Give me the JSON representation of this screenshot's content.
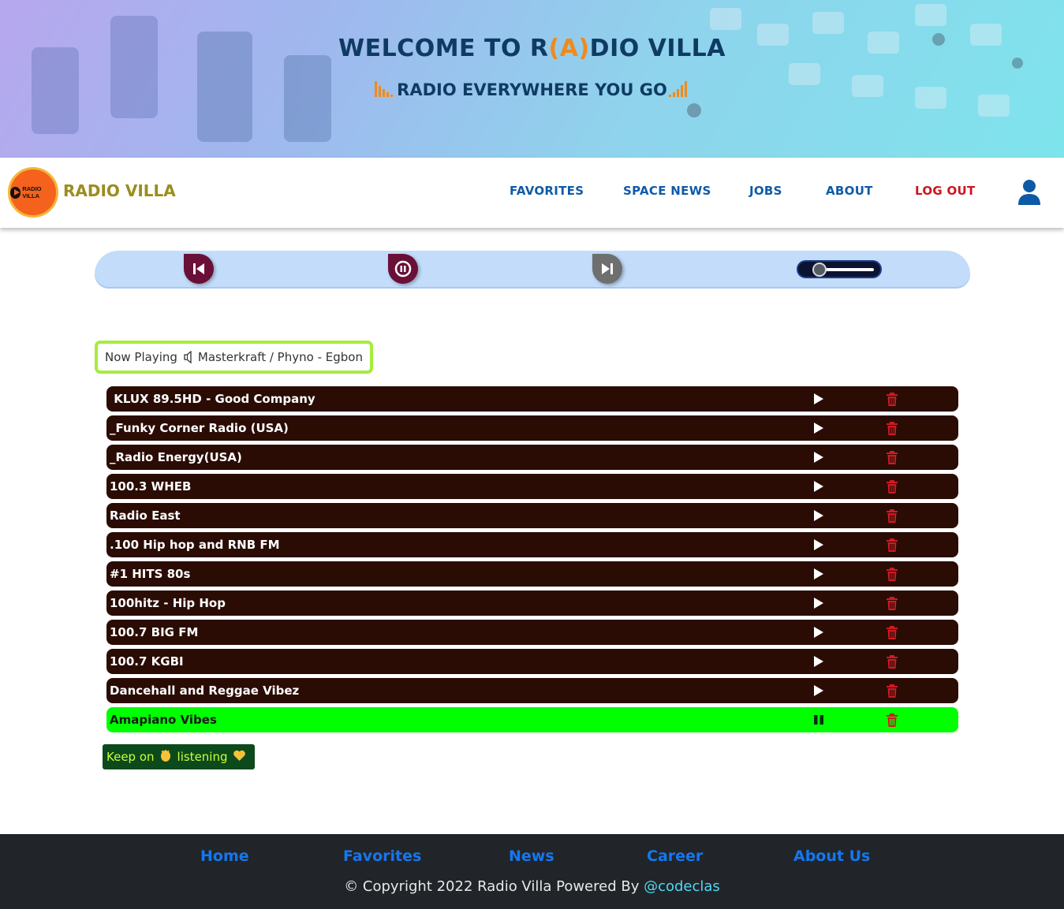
{
  "hero": {
    "title_pre": "WELCOME TO R",
    "title_ant": "A",
    "title_post": "DIO VILLA",
    "subtitle": "RADIO EVERYWHERE YOU GO",
    "accent": "#f08a1c"
  },
  "navbar": {
    "logo_text": "RADIO VILLA",
    "brand": "RADIO VILLA",
    "links": [
      "FAVORITES",
      "SPACE NEWS",
      "JOBS",
      "ABOUT",
      "LOG OUT"
    ]
  },
  "player": {
    "prev_icon": "skip-back-icon",
    "pause_icon": "pause-icon",
    "next_icon": "skip-forward-icon",
    "volume_level": 0.05
  },
  "now_playing": {
    "label": "Now Playing",
    "track": "Masterkraft / Phyno - Egbon"
  },
  "stations": [
    {
      "name": " KLUX 89.5HD - Good Company",
      "state": "play"
    },
    {
      "name": "_Funky Corner Radio (USA)",
      "state": "play"
    },
    {
      "name": "_Radio Energy(USA)",
      "state": "play"
    },
    {
      "name": "100.3 WHEB",
      "state": "play"
    },
    {
      "name": "Radio East",
      "state": "play"
    },
    {
      "name": ".100 Hip hop and RNB FM",
      "state": "play"
    },
    {
      "name": "#1 HITS 80s",
      "state": "play"
    },
    {
      "name": "100hitz - Hip Hop",
      "state": "play"
    },
    {
      "name": "100.7 BIG FM",
      "state": "play"
    },
    {
      "name": "100.7 KGBI",
      "state": "play"
    },
    {
      "name": "Dancehall and Reggae Vibez",
      "state": "play"
    },
    {
      "name": "Amapiano Vibes",
      "state": "pause"
    }
  ],
  "keep": {
    "pre": "Keep on",
    "post": "listening",
    "emoji1": "👏",
    "emoji2": "💛"
  },
  "footer": {
    "links": [
      "Home",
      "Favorites",
      "News",
      "Career",
      "About Us"
    ],
    "copyright": "© Copyright 2022 Radio Villa Powered By ",
    "handle": "@codeclas"
  },
  "colors": {
    "row_bg": "#2a0c04",
    "row_active": "#00ff00",
    "delete": "#d01a24",
    "nav": "#0f5aa7",
    "logout": "#c9151f"
  }
}
